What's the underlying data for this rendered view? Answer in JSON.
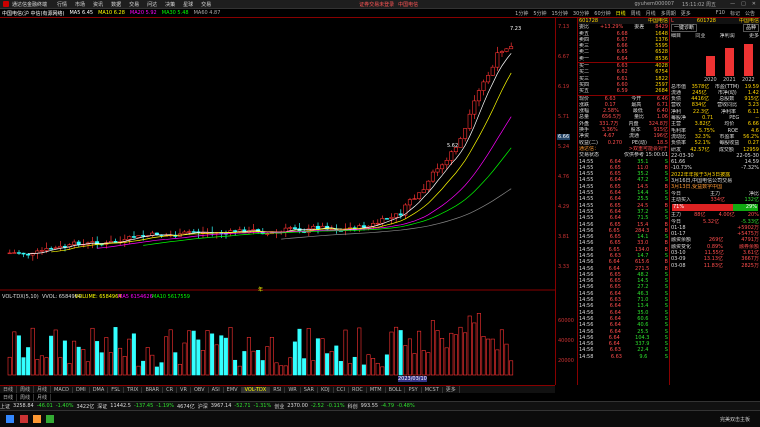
{
  "titlebar": {
    "title": "通达信金融终端",
    "menus": [
      "行情",
      "市场",
      "资讯",
      "数据",
      "交易",
      "问达",
      "决策",
      "星球",
      "交易"
    ],
    "center_text": "证券交易未登录",
    "center_text2": "中国电信",
    "user": "gyuhem000007",
    "time": "15:11:02 周五"
  },
  "toolbar": {
    "items": [
      "中国电信(沪 中信(有源网络)",
      "MA5 6.45",
      "MA10 6.28",
      "MA20 5.92",
      "MA30 5.48",
      "MA60 4.87"
    ],
    "periods": [
      "1分钟",
      "5分钟",
      "15分钟",
      "30分钟",
      "60分钟",
      "日线",
      "周线",
      "月线",
      "多周期",
      "更多"
    ],
    "right": [
      "F10",
      "标记",
      "公告"
    ]
  },
  "chart": {
    "price_labels": [
      "7.23",
      "7.11",
      "5.62",
      "5.63"
    ],
    "axis": [
      "7.13",
      "6.67",
      "6.19",
      "5.71",
      "5.24",
      "4.76",
      "4.29",
      "3.81",
      "3.33"
    ],
    "vol_axis": [
      "100",
      "60000",
      "40000",
      "20000"
    ],
    "left_label": "6.66",
    "mid_labels": [
      "年",
      "2023/03/10",
      "1",
      "2"
    ],
    "vol_legend": [
      "VOL-TDX(5,10)",
      "VVOL: 6584964",
      "VOLUME: 6584964",
      "MA5 6154626",
      "MA10 5617559"
    ]
  },
  "quote": {
    "code": "601728",
    "name": "中国电信",
    "header": [
      "委比",
      "+13.29%",
      "委差",
      "8429"
    ],
    "asks": [
      [
        "卖五",
        "6.68",
        "1648"
      ],
      [
        "卖四",
        "6.67",
        "1376"
      ],
      [
        "卖三",
        "6.66",
        "5595"
      ],
      [
        "卖二",
        "6.65",
        "6528"
      ],
      [
        "卖一",
        "6.64",
        "8536"
      ]
    ],
    "bids": [
      [
        "买一",
        "6.63",
        "4028"
      ],
      [
        "买二",
        "6.62",
        "6754"
      ],
      [
        "买三",
        "6.61",
        "1822"
      ],
      [
        "买四",
        "6.60",
        "2597"
      ],
      [
        "买五",
        "6.59",
        "2684"
      ]
    ],
    "stats": [
      [
        "现价",
        "6.63",
        "今开",
        "6.46"
      ],
      [
        "涨跌",
        "0.17",
        "最高",
        "6.71"
      ],
      [
        "涨幅",
        "2.58%",
        "最低",
        "6.40"
      ],
      [
        "总量",
        "656.5万",
        "量比",
        "1.06"
      ],
      [
        "外盘",
        "331.7万",
        "内盘",
        "324.8万"
      ],
      [
        "换手",
        "3.36%",
        "股本",
        "915亿"
      ],
      [
        "净资",
        "4.67",
        "流通",
        "196亿"
      ],
      [
        "收益(二)",
        "0.270",
        "PE(动)",
        "18.5"
      ]
    ],
    "notice": [
      "通达信：",
      ">双重可能会对于",
      "财务相关",
      "交易状态",
      "仅供参考  15:00:01"
    ],
    "ticks": [
      [
        "14:55",
        "6.64",
        "35.1",
        "S"
      ],
      [
        "14:55",
        "6.65",
        "11.0",
        "B"
      ],
      [
        "14:55",
        "6.65",
        "35.2",
        "S"
      ],
      [
        "14:55",
        "6.64",
        "47.2",
        "S"
      ],
      [
        "14:55",
        "6.65",
        "14.5",
        "B"
      ],
      [
        "14:55",
        "6.64",
        "14.4",
        "S"
      ],
      [
        "14:55",
        "6.64",
        "25.5",
        "S"
      ],
      [
        "14:55",
        "6.65",
        "24.5",
        "B"
      ],
      [
        "14:55",
        "6.64",
        "37.2",
        "S"
      ],
      [
        "14:55",
        "6.64",
        "71.5",
        "S"
      ],
      [
        "14:56",
        "6.65",
        "15.4",
        "B"
      ],
      [
        "14:56",
        "6.65",
        "284.3",
        "B"
      ],
      [
        "14:56",
        "6.65",
        "14.1",
        "S"
      ],
      [
        "14:56",
        "6.65",
        "33.0",
        "B"
      ],
      [
        "14:56",
        "6.65",
        "134.0",
        "B"
      ],
      [
        "14:56",
        "6.63",
        "14.7",
        "S"
      ],
      [
        "14:56",
        "6.64",
        "615.6",
        "B"
      ],
      [
        "14:56",
        "6.64",
        "271.5",
        "B"
      ],
      [
        "14:56",
        "6.65",
        "48.2",
        "S"
      ],
      [
        "14:56",
        "6.65",
        "14.5",
        "S"
      ],
      [
        "14:56",
        "6.65",
        "27.2",
        "S"
      ],
      [
        "14:56",
        "6.64",
        "46.3",
        "S"
      ],
      [
        "14:56",
        "6.63",
        "71.0",
        "S"
      ],
      [
        "14:56",
        "6.64",
        "13.4",
        "S"
      ],
      [
        "14:56",
        "6.64",
        "35.0",
        "S"
      ],
      [
        "14:56",
        "6.64",
        "60.6",
        "S"
      ],
      [
        "14:56",
        "6.64",
        "40.6",
        "S"
      ],
      [
        "14:56",
        "6.64",
        "25.5",
        "S"
      ],
      [
        "14:56",
        "6.64",
        "104.3",
        "S"
      ],
      [
        "14:56",
        "6.64",
        "337.9",
        "S"
      ],
      [
        "14:56",
        "6.63",
        "22.4",
        "S"
      ],
      [
        "14:58",
        "6.63",
        "9.6",
        "S"
      ]
    ]
  },
  "fin": {
    "head": [
      "L",
      "601728",
      "中国电信"
    ],
    "btns": [
      "一键诊断",
      "品种"
    ],
    "tabs": [
      "细目",
      "同业",
      "净利润",
      "更多"
    ],
    "years": [
      "2020",
      "2021",
      "2022"
    ],
    "rows": [
      [
        "总市值",
        "3578亿",
        "市盈(TTM)",
        "19.59"
      ],
      [
        "流通",
        "245亿",
        "市净(动)",
        "1.42"
      ],
      [
        "负债",
        "4416亿",
        "总股数",
        "915亿"
      ],
      [
        "营收",
        "834亿",
        "营收同比",
        "3.23"
      ],
      [
        "净利",
        "22.3亿",
        "净利率",
        "6.11"
      ],
      [
        "每股净",
        "0.71",
        "PEG",
        "--"
      ],
      [
        "主营",
        "3.82亿",
        "均价",
        "6.66"
      ],
      [
        "毛利率",
        "5.75%",
        "ROE",
        "4.6"
      ],
      [
        "流动比",
        "32.3%",
        "市盈率",
        "56.2%"
      ],
      [
        "负债率",
        "52.1%",
        "每股收益",
        "0.27"
      ],
      [
        "研发",
        "42.57亿",
        "成交额",
        "12959"
      ]
    ],
    "dates": [
      [
        "22-03-30",
        "22-05-30"
      ],
      [
        "61.66",
        "14.59"
      ],
      [
        "-10.73%",
        "-7.32%"
      ]
    ],
    "news": [
      "2022年年报于3月3日披露",
      "3月16日,中国电信公司交易",
      "3月13日,受益数字中国"
    ],
    "flow": [
      [
        "今日",
        "主力",
        "净比"
      ],
      [
        "主动买入",
        "334亿",
        "132亿"
      ]
    ],
    "pct": [
      "71%",
      "29%"
    ],
    "bottom": [
      [
        "主力",
        "88亿",
        "4.00亿",
        "20%"
      ],
      [
        "今日",
        "5.32亿",
        "-5.33亿"
      ],
      [
        "01-18",
        "",
        "+5902万"
      ],
      [
        "01-17",
        "",
        "+5475万"
      ],
      [
        "融资余额",
        "269亿",
        "4791万"
      ],
      [
        "融资变化",
        "0.89%",
        "融券余额"
      ],
      [
        "03-10",
        "11.55亿",
        "3.61亿"
      ],
      [
        "03-09",
        "13.13亿",
        "3667万"
      ],
      [
        "03-08",
        "11.83亿",
        "2825万"
      ]
    ]
  },
  "tabs": [
    "日线",
    "周线",
    "月线",
    "MACD",
    "DMI",
    "DMA",
    "FSL",
    "TRIX",
    "BRAR",
    "CR",
    "VR",
    "OBV",
    "ASI",
    "EMV",
    "VOL-TDX",
    "RSI",
    "WR",
    "SAR",
    "KDJ",
    "CCI",
    "ROC",
    "MTM",
    "BOLL",
    "PSY",
    "MCST",
    "更多"
  ],
  "active_tab": "VOL-TDX",
  "status": {
    "items": [
      [
        "上证",
        "3258.84",
        "-46.01",
        "-1.40%",
        "3422亿"
      ],
      [
        "深证",
        "11442.5",
        "-137.45",
        "-1.19%",
        "4674亿"
      ],
      [
        "沪深",
        "3967.14",
        "-52.71",
        "-1.31%"
      ],
      [
        "创业",
        "2370.00",
        "-2.52",
        "-0.11%"
      ],
      [
        "科创",
        "993.55",
        "-4.79",
        "-0.48%"
      ]
    ],
    "tip": "完美双击主板"
  },
  "colors": {
    "up": "#ff4d4d",
    "down": "#2ee02e",
    "axis": "#800000"
  }
}
